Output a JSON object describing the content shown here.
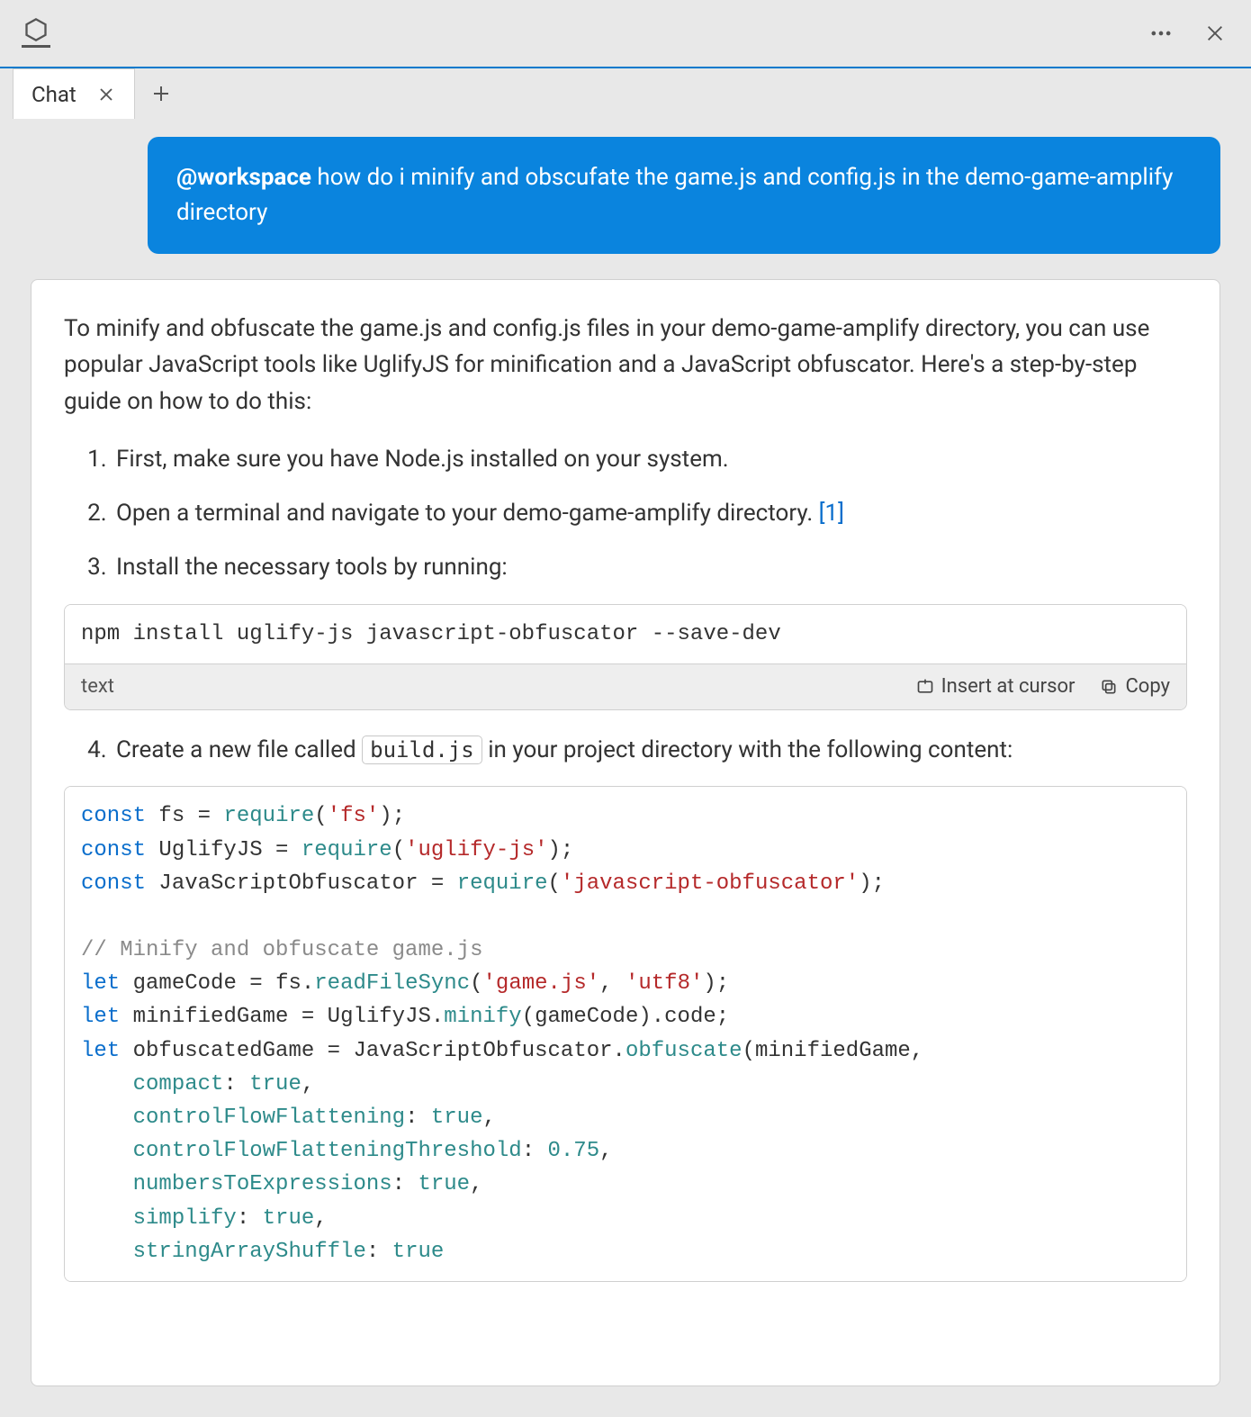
{
  "titlebar": {
    "appIconName": "hexagon-icon"
  },
  "tabs": {
    "active": {
      "label": "Chat"
    }
  },
  "chat": {
    "user": {
      "mention": "@workspace",
      "text": " how do i minify and obscufate the game.js and config.js in the demo-game-amplify directory"
    },
    "assistant": {
      "intro": "To minify and obfuscate the game.js and config.js files in your demo-game-amplify directory, you can use popular JavaScript tools like UglifyJS for minification and a JavaScript obfuscator. Here's a step-by-step guide on how to do this:",
      "steps": {
        "s1": "First, make sure you have Node.js installed on your system.",
        "s2_pre": "Open a terminal and navigate to your demo-game-amplify directory. ",
        "s2_cite": "[1]",
        "s3": "Install the necessary tools by running:",
        "s4_pre": "Create a new file called ",
        "s4_code": "build.js",
        "s4_post": " in your project directory with the following content:"
      }
    }
  },
  "codeblocks": {
    "install": {
      "lang": "text",
      "code": "npm install uglify-js javascript-obfuscator --save-dev",
      "actions": {
        "insert": "Insert at cursor",
        "copy": "Copy"
      }
    },
    "build": {
      "strings": {
        "fs": "'fs'",
        "uglify": "'uglify-js'",
        "obf": "'javascript-obfuscator'",
        "gamejs": "'game.js'",
        "utf8": "'utf8'"
      },
      "comment": "// Minify and obfuscate game.js",
      "numbers": {
        "threshold": "0.75"
      },
      "idents": {
        "const": "const",
        "let": "let",
        "require": "require",
        "fs": "fs",
        "UglifyJS": "UglifyJS",
        "JavaScriptObfuscator": "JavaScriptObfuscator",
        "gameCode": "gameCode",
        "minifiedGame": "minifiedGame",
        "obfuscatedGame": "obfuscatedGame",
        "readFileSync": "readFileSync",
        "minify": "minify",
        "code": "code",
        "obfuscate": "obfuscate",
        "compact": "compact",
        "controlFlowFlattening": "controlFlowFlattening",
        "controlFlowFlatteningThreshold": "controlFlowFlatteningThreshold",
        "numbersToExpressions": "numbersToExpressions",
        "simplify": "simplify",
        "stringArrayShuffle": "stringArrayShuffle",
        "true": "true"
      }
    }
  }
}
